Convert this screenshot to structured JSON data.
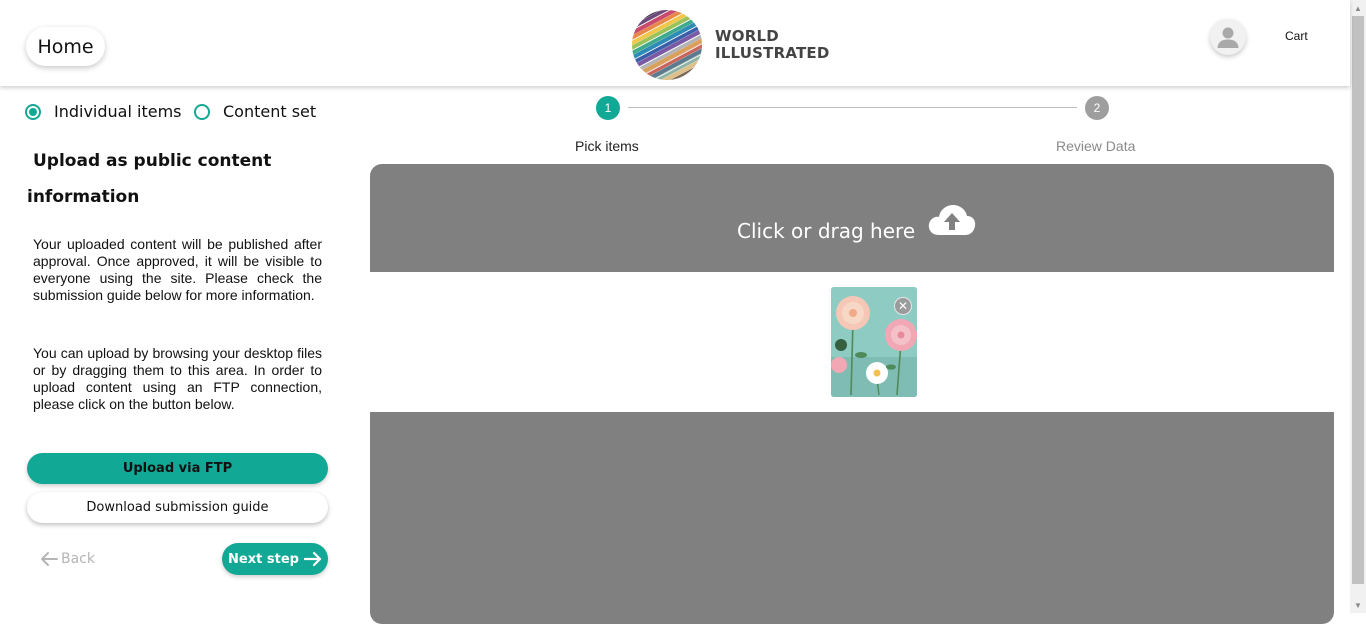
{
  "header": {
    "home_label": "Home",
    "logo_line1": "WORLD",
    "logo_line2": "ILLUSTRATED",
    "cart_label": "Cart"
  },
  "upload_mode": {
    "options": [
      {
        "label": "Individual items",
        "selected": true
      },
      {
        "label": "Content set",
        "selected": false
      }
    ]
  },
  "left_panel": {
    "title_line1": "Upload as public content",
    "title_line2": "information",
    "paragraph1": "Your uploaded content will be published after approval. Once approved, it will be visible to everyone using the site. Please check the submission guide below for more information.",
    "paragraph2": "You can upload by browsing your desktop files or by dragging them to this area. In order to upload content using an FTP connection, please click on the button below.",
    "ftp_button": "Upload via FTP",
    "guide_button": "Download submission guide",
    "back_button": "Back",
    "next_button": "Next step"
  },
  "stepper": {
    "steps": [
      {
        "number": "1",
        "label": "Pick items",
        "active": true
      },
      {
        "number": "2",
        "label": "Review Data",
        "active": false
      }
    ]
  },
  "dropzone": {
    "prompt": "Click or drag here",
    "icon": "cloud-upload-icon",
    "thumbnails": [
      {
        "description_icon": "flower-image",
        "remove_icon": "close-icon"
      }
    ]
  },
  "colors": {
    "accent": "#12a896",
    "dropzone_bg": "#808080",
    "inactive_step": "#9e9e9e"
  }
}
